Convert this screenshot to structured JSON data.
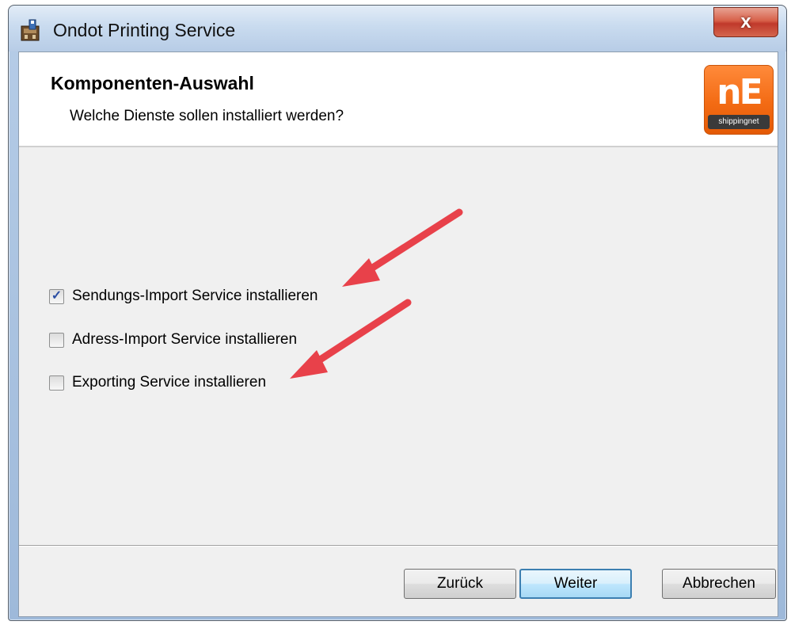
{
  "window": {
    "title": "Ondot Printing Service",
    "close_label": "x"
  },
  "header": {
    "title": "Komponenten-Auswahl",
    "subtitle": "Welche Dienste sollen installiert werden?",
    "logo_letters": "nE",
    "logo_brand": "shippingnet"
  },
  "options": [
    {
      "label": "Sendungs-Import Service installieren",
      "checked": true
    },
    {
      "label": "Adress-Import Service installieren",
      "checked": false
    },
    {
      "label": "Exporting Service installieren",
      "checked": false
    }
  ],
  "check_glyph": "✓",
  "buttons": {
    "back": "Zurück",
    "next": "Weiter",
    "cancel": "Abbrechen"
  },
  "colors": {
    "annotation_arrow": "#e8414a",
    "logo_orange": "#f36b14"
  }
}
